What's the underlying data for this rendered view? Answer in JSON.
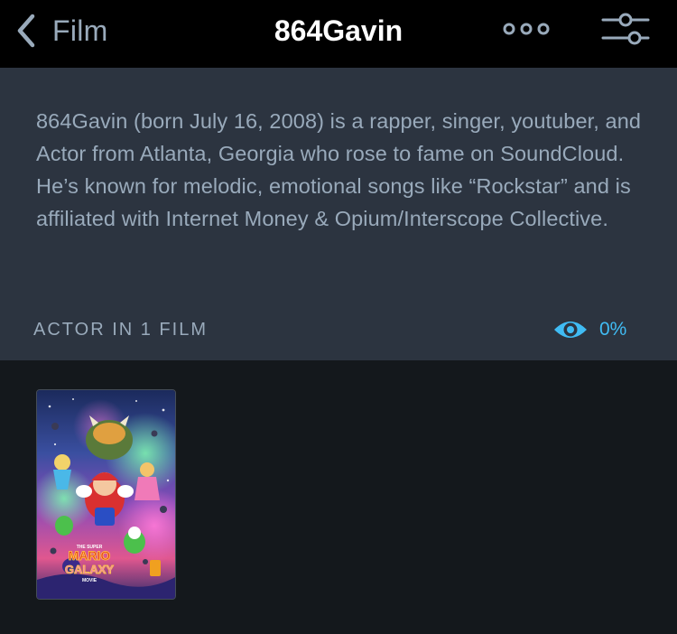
{
  "nav": {
    "back_label": "Film",
    "title": "864Gavin",
    "back_icon": "chevron-left-icon",
    "more_icon": "ellipsis-icon",
    "filter_icon": "sliders-icon"
  },
  "bio": {
    "text": "864Gavin (born July 16, 2008) is a rapper, singer, youtuber, and Actor from Atlanta, Georgia who rose to fame on SoundCloud. He’s known for melodic, emotional songs like “Rockstar” and is affiliated with Internet Money & Opium/Interscope Collective."
  },
  "filmography": {
    "section_label": "ACTOR IN 1 FILM",
    "watched_icon": "eye-icon",
    "watched_percent": "0%",
    "films": [
      {
        "poster_title_line1": "THE SUPER",
        "poster_title_line2": "MARIO",
        "poster_title_line3": "GALAXY",
        "poster_title_line4": "MOVIE"
      }
    ]
  },
  "colors": {
    "nav_bg": "#000000",
    "panel_bg": "#2c3440",
    "page_bg": "#14181c",
    "text_muted": "#99aabb",
    "accent_blue": "#40bcf4"
  }
}
